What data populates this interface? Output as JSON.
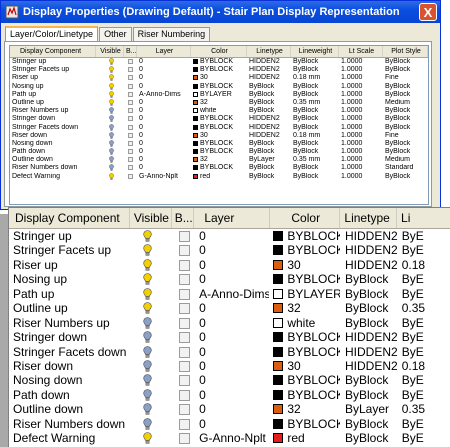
{
  "window": {
    "title": "Display Properties (Drawing Default) - Stair Plan Display Representation",
    "close_glyph": "X"
  },
  "tabs": [
    "Layer/Color/Linetype",
    "Other",
    "Riser Numbering"
  ],
  "grid_columns": {
    "small": [
      "Display Component",
      "Visible",
      "B...",
      "Layer",
      "Color",
      "Linetype",
      "Lineweight",
      "Lt Scale",
      "Plot Style"
    ],
    "zoom": [
      "Display Component",
      "Visible",
      "B...",
      "Layer",
      "Color",
      "Linetype",
      "Li"
    ]
  },
  "colors": {
    "titlebar": "#0a4ee0",
    "swatch_black": "#000000",
    "swatch_orange": "#d95f0e",
    "swatch_white": "#ffffff",
    "swatch_red": "#e02020",
    "bulb_on": "#f5d000",
    "bulb_off": "#8aa0c8"
  },
  "rows": [
    {
      "component": "Stringer up",
      "visible": true,
      "layer": "0",
      "color": "BYBLOCK",
      "swatch": "black",
      "linetype": "HIDDEN2",
      "lineweight": "ByBlock",
      "ltscale": "1.0000",
      "plotstyle": "ByBlock",
      "zlw": "ByE"
    },
    {
      "component": "Stringer Facets up",
      "visible": true,
      "layer": "0",
      "color": "BYBLOCK",
      "swatch": "black",
      "linetype": "HIDDEN2",
      "lineweight": "ByBlock",
      "ltscale": "1.0000",
      "plotstyle": "ByBlock",
      "zlw": "ByE"
    },
    {
      "component": "Riser up",
      "visible": true,
      "layer": "0",
      "color": "30",
      "swatch": "orange",
      "linetype": "HIDDEN2",
      "lineweight": "0.18 mm",
      "ltscale": "1.0000",
      "plotstyle": "Fine",
      "zlw": "0.18"
    },
    {
      "component": "Nosing up",
      "visible": true,
      "layer": "0",
      "color": "BYBLOCK",
      "swatch": "black",
      "linetype": "ByBlock",
      "lineweight": "ByBlock",
      "ltscale": "1.0000",
      "plotstyle": "ByBlock",
      "zlw": "ByE"
    },
    {
      "component": "Path up",
      "visible": true,
      "layer": "A-Anno-Dims",
      "color": "BYLAYER",
      "swatch": "white",
      "linetype": "ByBlock",
      "lineweight": "ByBlock",
      "ltscale": "1.0000",
      "plotstyle": "ByBlock",
      "zlw": "ByE"
    },
    {
      "component": "Outline up",
      "visible": true,
      "layer": "0",
      "color": "32",
      "swatch": "orange",
      "linetype": "ByBlock",
      "lineweight": "0.35 mm",
      "ltscale": "1.0000",
      "plotstyle": "Medium",
      "zlw": "0.35"
    },
    {
      "component": "Riser Numbers up",
      "visible": false,
      "layer": "0",
      "color": "white",
      "swatch": "white",
      "linetype": "ByBlock",
      "lineweight": "ByBlock",
      "ltscale": "1.0000",
      "plotstyle": "ByBlock",
      "zlw": "ByE"
    },
    {
      "component": "Stringer down",
      "visible": false,
      "layer": "0",
      "color": "BYBLOCK",
      "swatch": "black",
      "linetype": "HIDDEN2",
      "lineweight": "ByBlock",
      "ltscale": "1.0000",
      "plotstyle": "ByBlock",
      "zlw": "ByE"
    },
    {
      "component": "Stringer Facets down",
      "visible": false,
      "layer": "0",
      "color": "BYBLOCK",
      "swatch": "black",
      "linetype": "HIDDEN2",
      "lineweight": "ByBlock",
      "ltscale": "1.0000",
      "plotstyle": "ByBlock",
      "zlw": "ByE"
    },
    {
      "component": "Riser down",
      "visible": false,
      "layer": "0",
      "color": "30",
      "swatch": "orange",
      "linetype": "HIDDEN2",
      "lineweight": "0.18 mm",
      "ltscale": "1.0000",
      "plotstyle": "Fine",
      "zlw": "0.18"
    },
    {
      "component": "Nosing down",
      "visible": false,
      "layer": "0",
      "color": "BYBLOCK",
      "swatch": "black",
      "linetype": "ByBlock",
      "lineweight": "ByBlock",
      "ltscale": "1.0000",
      "plotstyle": "ByBlock",
      "zlw": "ByE"
    },
    {
      "component": "Path down",
      "visible": false,
      "layer": "0",
      "color": "BYBLOCK",
      "swatch": "black",
      "linetype": "ByBlock",
      "lineweight": "ByBlock",
      "ltscale": "1.0000",
      "plotstyle": "ByBlock",
      "zlw": "ByE"
    },
    {
      "component": "Outline down",
      "visible": false,
      "layer": "0",
      "color": "32",
      "swatch": "orange",
      "linetype": "ByLayer",
      "lineweight": "0.35 mm",
      "ltscale": "1.0000",
      "plotstyle": "Medium",
      "zlw": "0.35"
    },
    {
      "component": "Riser Numbers down",
      "visible": false,
      "layer": "0",
      "color": "BYBLOCK",
      "swatch": "black",
      "linetype": "ByBlock",
      "lineweight": "ByBlock",
      "ltscale": "1.0000",
      "plotstyle": "Standard",
      "zlw": "ByE"
    },
    {
      "component": "Defect Warning",
      "visible": true,
      "layer": "G-Anno-Nplt",
      "color": "red",
      "swatch": "red",
      "linetype": "ByBlock",
      "lineweight": "ByBlock",
      "ltscale": "1.0000",
      "plotstyle": "ByBlock",
      "zlw": "ByE"
    }
  ]
}
